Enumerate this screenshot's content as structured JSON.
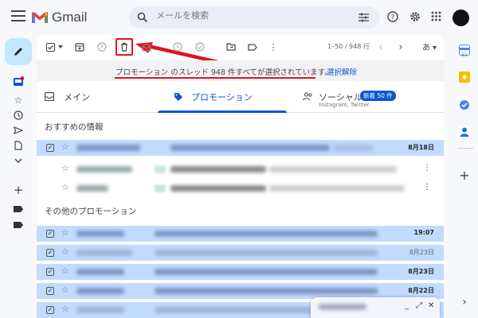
{
  "app": {
    "name": "Gmail"
  },
  "search": {
    "placeholder": "メールを検索"
  },
  "toolbar": {
    "page_info": "1–50 / 948 行",
    "lang_label": "あ ▾"
  },
  "banner": {
    "message": "プロモーション のスレッド 948 件すべてが選択されています。",
    "undo": "選択解除"
  },
  "tabs": [
    {
      "label": "メイン"
    },
    {
      "label": "プロモーション"
    },
    {
      "label": "ソーシャル",
      "badge": "新着 50 件",
      "sub": "Instagram, Twitter"
    }
  ],
  "sections": {
    "recommended": "おすすめの情報",
    "others": "その他のプロモーション"
  },
  "rows": [
    {
      "date": "8月18日",
      "selected": true,
      "read": false
    },
    {
      "date": "",
      "selected": false,
      "read": true
    },
    {
      "date": "",
      "selected": false,
      "read": true
    },
    {
      "date": "19:07",
      "selected": true,
      "read": false
    },
    {
      "date": "8月23日",
      "selected": true,
      "read": true
    },
    {
      "date": "8月23日",
      "selected": true,
      "read": false
    },
    {
      "date": "8月22日",
      "selected": true,
      "read": false
    }
  ],
  "colors": {
    "accent": "#0b57d0",
    "selected_row": "#c2dbff",
    "highlight": "#e0141e",
    "compose": "#c2e7ff"
  },
  "icons": [
    "hamburger-icon",
    "search-icon",
    "tune-icon",
    "help-icon",
    "gear-icon",
    "apps-icon",
    "pencil-icon",
    "inbox-icon",
    "star-icon",
    "clock-icon",
    "send-icon",
    "file-icon",
    "chevron-down-icon",
    "plus-icon",
    "label-icon",
    "archive-icon",
    "report-icon",
    "trash-icon",
    "mail-icon",
    "snooze-icon",
    "task-icon",
    "move-icon",
    "tag-icon",
    "more-icon",
    "calendar-icon",
    "keep-icon",
    "tasks-icon",
    "contacts-icon"
  ]
}
